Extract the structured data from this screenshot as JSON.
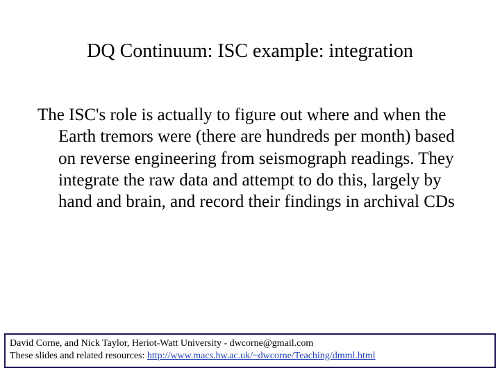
{
  "title": "DQ Continuum: ISC example: integration",
  "body": "The ISC's  role is actually to figure out where and when the Earth tremors were (there are hundreds per month) based on reverse engineering from seismograph readings. They integrate the raw data and attempt to do this, largely by hand and brain, and record their findings in archival CDs",
  "footer": {
    "line1_prefix": "David Corne, and Nick Taylor,  Heriot-Watt University  -  ",
    "line1_email": "dwcorne@gmail.com",
    "line2_prefix": "These slides and related resources:   ",
    "line2_link": "http://www.macs.hw.ac.uk/~dwcorne/Teaching/dmml.html"
  }
}
